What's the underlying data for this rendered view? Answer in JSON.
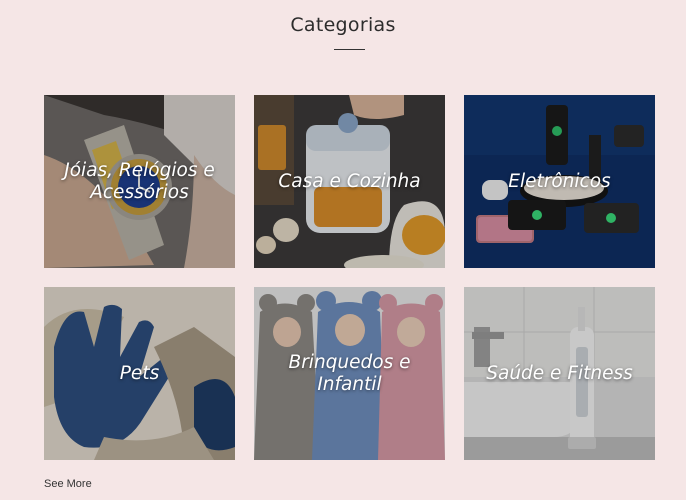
{
  "section": {
    "title": "Categorias",
    "see_more": "See More"
  },
  "categories": [
    {
      "label": "Jóias, Relógios e Acessórios",
      "image": "wristwatch-photo"
    },
    {
      "label": "Casa e Cozinha",
      "image": "food-chopper-photo"
    },
    {
      "label": "Eletrônicos",
      "image": "wireless-charger-photo"
    },
    {
      "label": "Pets",
      "image": "pet-grooming-glove-photo"
    },
    {
      "label": "Brinquedos e Infantil",
      "image": "baby-sleeping-bags-photo"
    },
    {
      "label": "Saúde e Fitness",
      "image": "water-flosser-photo"
    }
  ]
}
